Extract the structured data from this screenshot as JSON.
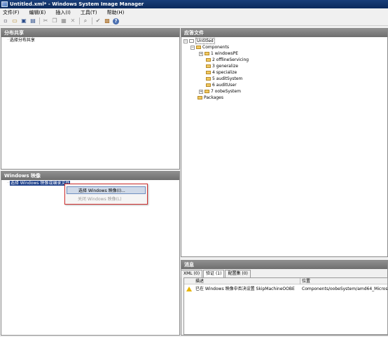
{
  "window": {
    "title": "Untitled.xml* - Windows System Image Manager"
  },
  "menu": [
    "文件(F)",
    "编辑(E)",
    "插入(I)",
    "工具(T)",
    "帮助(H)"
  ],
  "toolbar": [
    {
      "icon": "new-icon",
      "glyph": "▫"
    },
    {
      "icon": "open-icon",
      "glyph": "▭"
    },
    {
      "icon": "save-icon",
      "glyph": "▣"
    },
    {
      "icon": "save-as-icon",
      "glyph": "▤"
    },
    {
      "icon": "cut-icon",
      "glyph": "✂"
    },
    {
      "icon": "copy-icon",
      "glyph": "❐"
    },
    {
      "icon": "paste-icon",
      "glyph": "▦"
    },
    {
      "icon": "delete-icon",
      "glyph": "✕"
    },
    {
      "icon": "find-icon",
      "glyph": "⌕"
    },
    {
      "icon": "validate-icon",
      "glyph": "✔"
    },
    {
      "icon": "package-icon",
      "glyph": "▩"
    },
    {
      "icon": "help-icon",
      "glyph": "?"
    }
  ],
  "distribution_share": {
    "header": "分布共享",
    "placeholder": "选择分布共享"
  },
  "windows_image": {
    "header": "Windows 映像",
    "placeholder": "选择 Windows 映像或编录文件"
  },
  "context_menu": {
    "select_image": "选择 Windows 映像(I)...",
    "close_image": "关闭 Windows 映像(L)"
  },
  "answer_file": {
    "header": "应答文件",
    "root": "Untitled",
    "components": "Components",
    "passes": [
      "1 windowsPE",
      "2 offlineServicing",
      "3 generalize",
      "4 specialize",
      "5 auditSystem",
      "6 auditUser",
      "7 oobeSystem"
    ],
    "packages": "Packages"
  },
  "messages": {
    "header": "消息",
    "tabs": [
      "XML (0)",
      "验证 (1)",
      "配置集 (0)"
    ],
    "columns": [
      "描述",
      "位置"
    ],
    "rows": [
      {
        "description": "已在 Windows 映像中否决设置 SkipMachineOOBE",
        "location": "Components/oobeSystem/amd64_Microsoft"
      }
    ]
  }
}
